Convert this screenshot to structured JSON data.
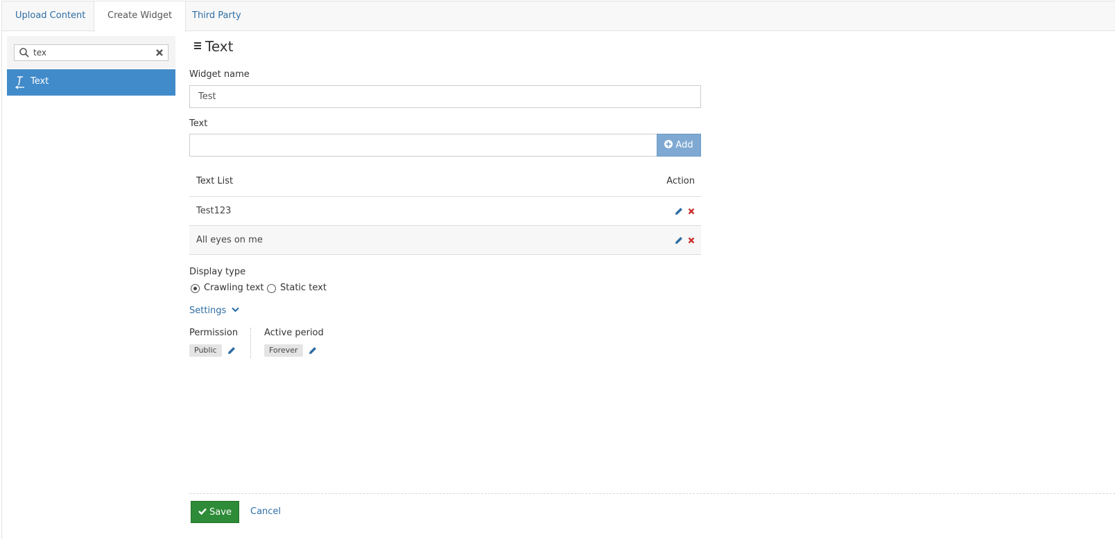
{
  "tabs": [
    {
      "label": "Upload Content",
      "active": false
    },
    {
      "label": "Create Widget",
      "active": true
    },
    {
      "label": "Third Party",
      "active": false
    }
  ],
  "sidebar": {
    "search": {
      "value": "tex",
      "placeholder": ""
    },
    "items": [
      {
        "label": "Text",
        "icon": "text-cursor-icon",
        "selected": true
      }
    ]
  },
  "main": {
    "title": "Text",
    "widget_name": {
      "label": "Widget name",
      "value": "Test"
    },
    "text_field": {
      "label": "Text",
      "value": "",
      "add_label": "Add"
    },
    "text_list": {
      "headers": {
        "list": "Text List",
        "action": "Action"
      },
      "rows": [
        {
          "text": "Test123"
        },
        {
          "text": "All eyes on me"
        }
      ]
    },
    "display_type": {
      "label": "Display type",
      "options": [
        {
          "label": "Crawling text",
          "checked": true
        },
        {
          "label": "Static text",
          "checked": false
        }
      ]
    },
    "settings_label": "Settings",
    "permission": {
      "label": "Permission",
      "value": "Public"
    },
    "active_period": {
      "label": "Active period",
      "value": "Forever"
    }
  },
  "footer": {
    "save_label": "Save",
    "cancel_label": "Cancel"
  },
  "colors": {
    "primary": "#428bca",
    "link": "#2e6da4",
    "save": "#2e8b37",
    "delete": "#c9302c",
    "add_button": "#7fa9d3"
  }
}
